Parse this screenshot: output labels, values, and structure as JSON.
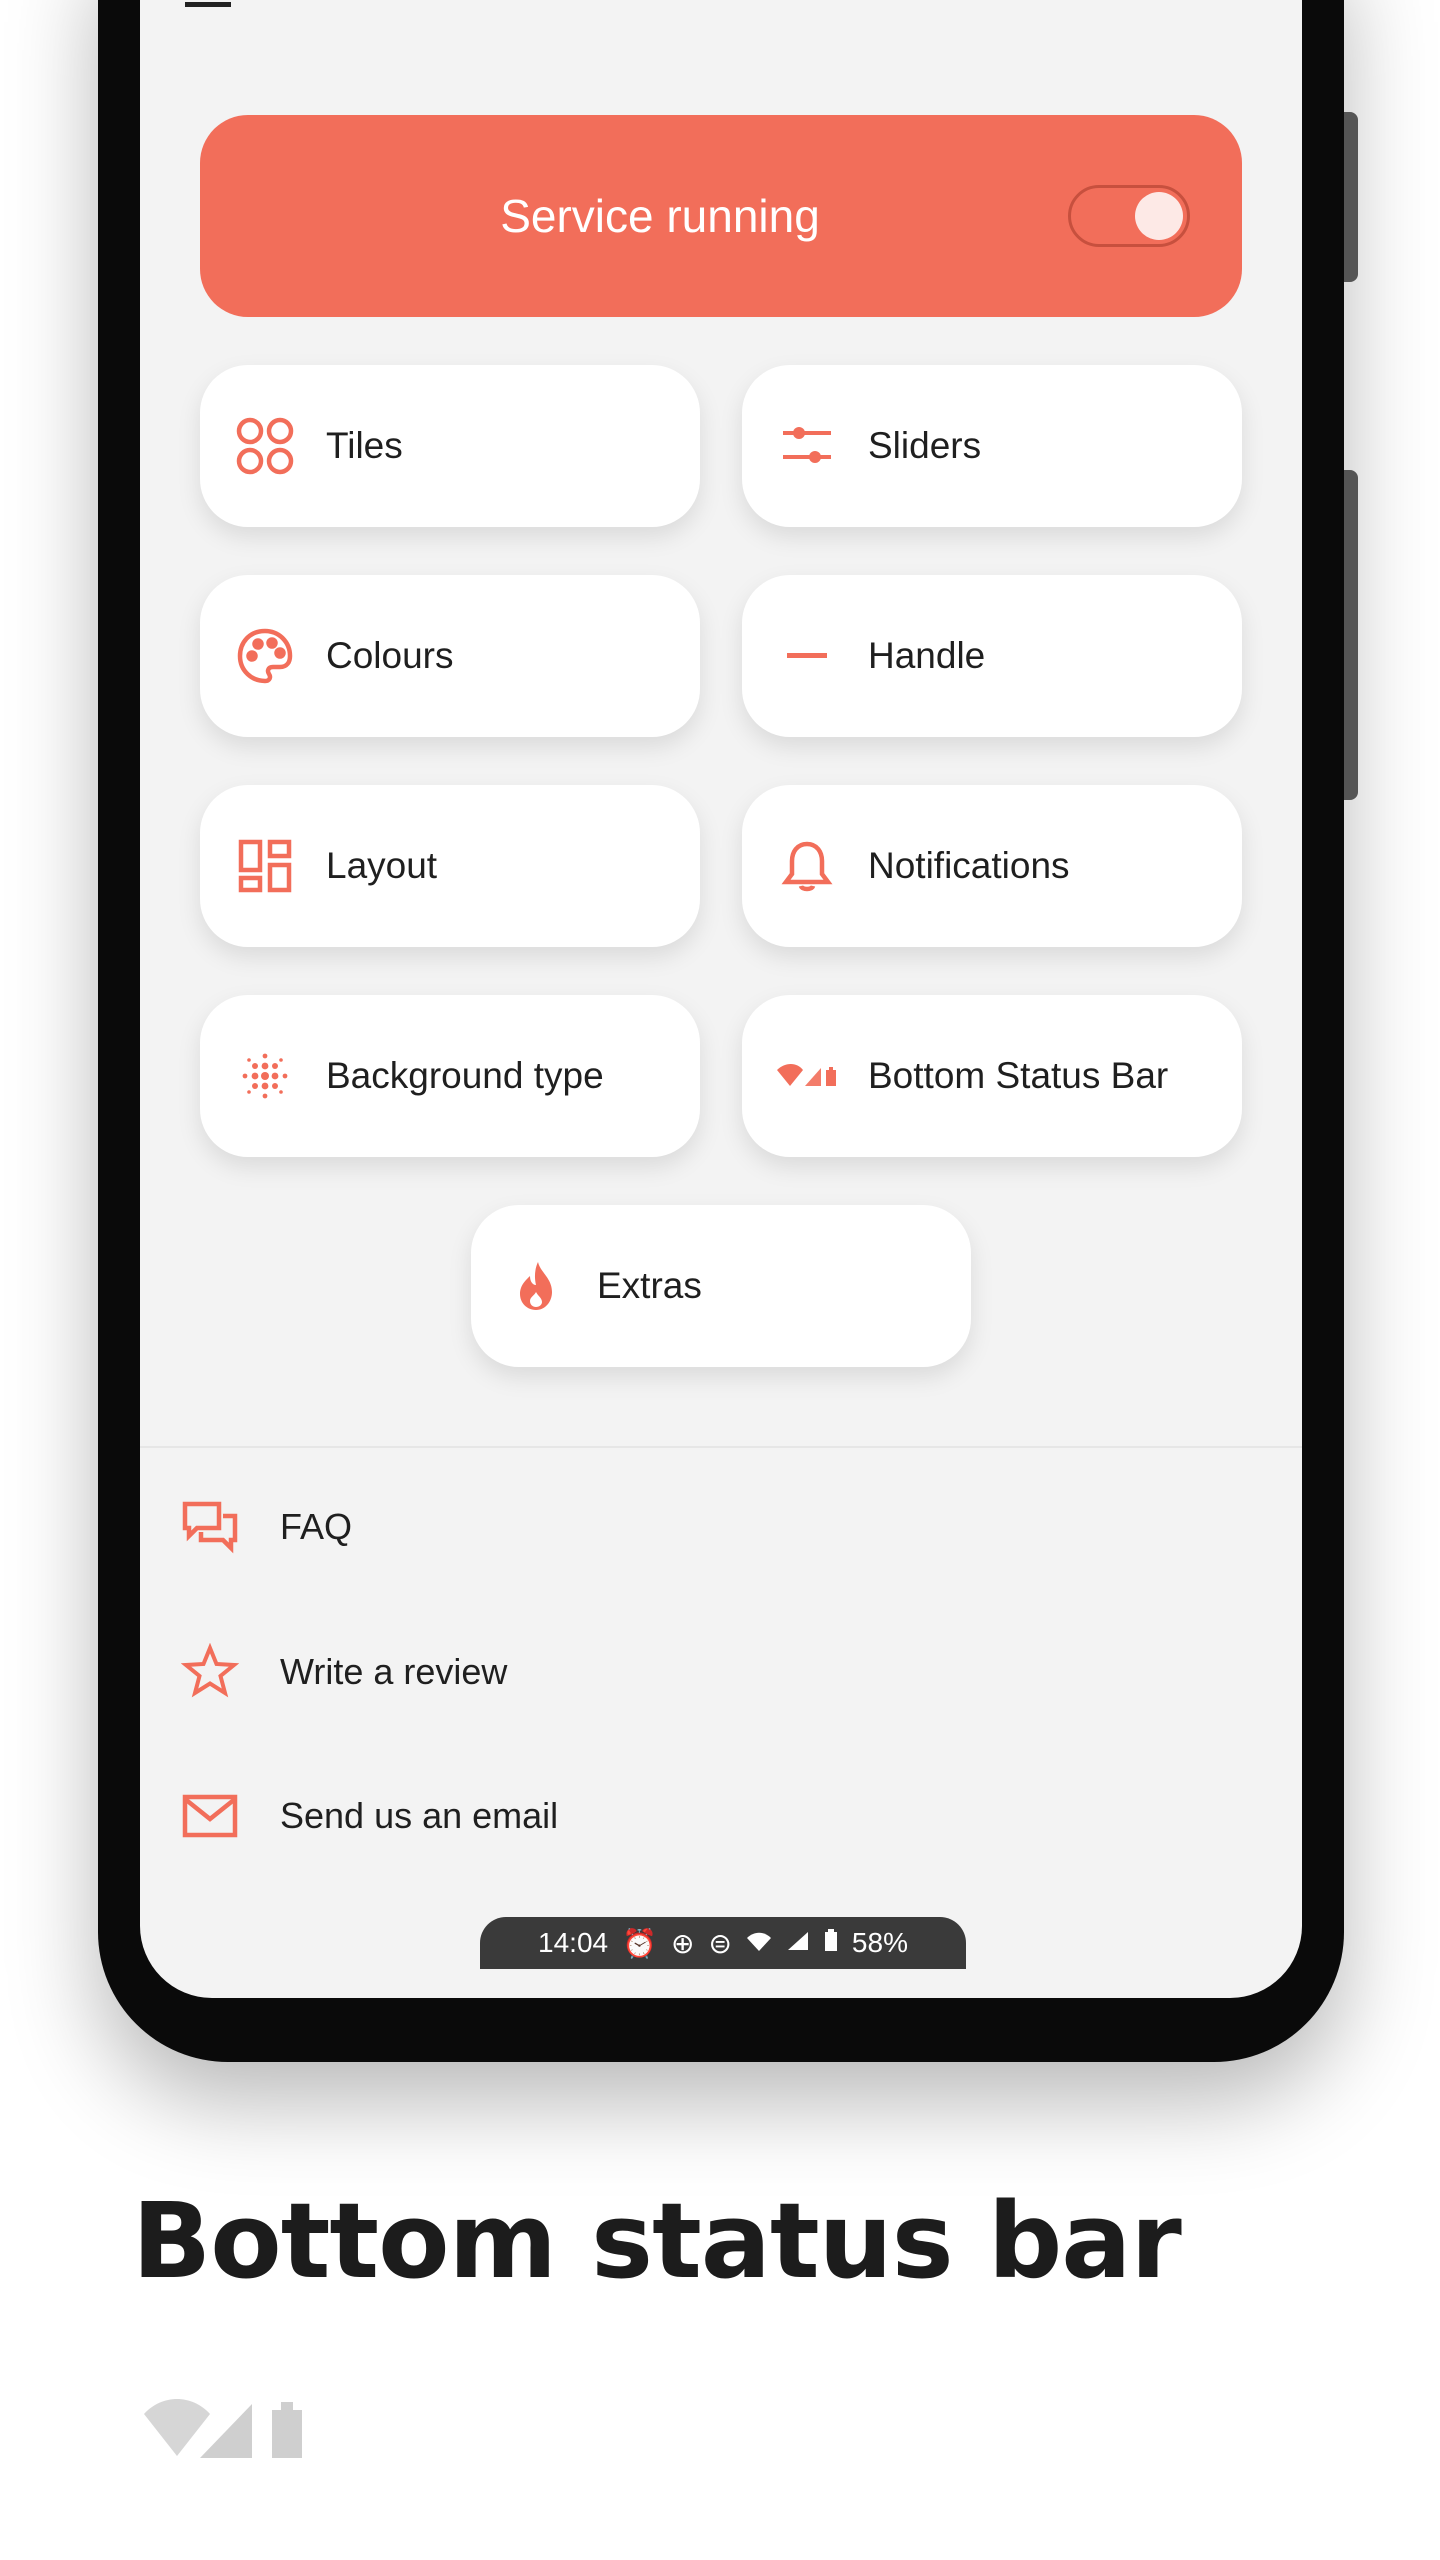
{
  "hero": {
    "label": "Service running",
    "toggle_on": true
  },
  "grid": [
    {
      "label": "Tiles",
      "icon": "tiles-icon"
    },
    {
      "label": "Sliders",
      "icon": "sliders-icon"
    },
    {
      "label": "Colours",
      "icon": "palette-icon"
    },
    {
      "label": "Handle",
      "icon": "handle-icon"
    },
    {
      "label": "Layout",
      "icon": "layout-icon"
    },
    {
      "label": "Notifications",
      "icon": "bell-icon"
    },
    {
      "label": "Background type",
      "icon": "dots-icon"
    },
    {
      "label": "Bottom Status Bar",
      "icon": "status-bar-icon"
    },
    {
      "label": "Extras",
      "icon": "flame-icon"
    }
  ],
  "menu": [
    {
      "label": "FAQ",
      "icon": "chat-icon"
    },
    {
      "label": "Write a review",
      "icon": "star-icon"
    },
    {
      "label": "Send us an email",
      "icon": "mail-icon"
    }
  ],
  "status_bar": {
    "time": "14:04",
    "battery": "58%"
  },
  "caption": {
    "title": "Bottom status bar"
  },
  "colors": {
    "accent": "#f26e5a",
    "screen_bg": "#f3f3f3"
  }
}
